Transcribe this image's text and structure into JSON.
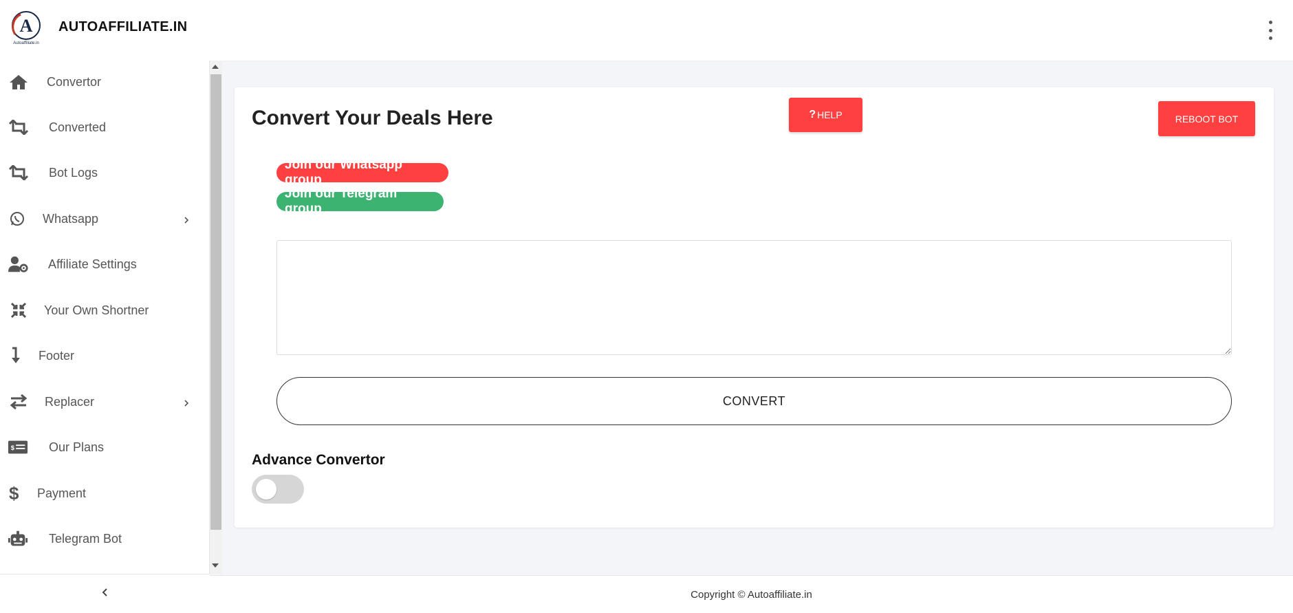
{
  "header": {
    "brand": "AUTOAFFILIATE.IN",
    "logo_caption": "Autoaffiliate.in",
    "more_icon": "kebab-vertical-icon"
  },
  "sidebar": {
    "items": [
      {
        "label": "Convertor",
        "icon": "home-icon"
      },
      {
        "label": "Converted",
        "icon": "repeat-icon"
      },
      {
        "label": "Bot Logs",
        "icon": "repeat-icon"
      },
      {
        "label": "Whatsapp",
        "icon": "whatsapp-icon",
        "has_submenu": true
      },
      {
        "label": "Affiliate Settings",
        "icon": "user-gear-icon"
      },
      {
        "label": "Your Own Shortner",
        "icon": "compress-icon"
      },
      {
        "label": "Footer",
        "icon": "arrow-down-turn-icon"
      },
      {
        "label": "Replacer",
        "icon": "exchange-icon",
        "has_submenu": true
      },
      {
        "label": "Our Plans",
        "icon": "money-card-icon"
      },
      {
        "label": "Payment",
        "icon": "dollar-icon"
      },
      {
        "label": "Telegram Bot",
        "icon": "robot-icon"
      }
    ],
    "collapse_icon": "chevron-left-icon"
  },
  "main": {
    "title": "Convert Your Deals Here",
    "help_label": "HELP",
    "reboot_label": "REBOOT BOT",
    "whatsapp_group_label": "Join our Whatsapp group",
    "telegram_group_label": "Join our Telegram group",
    "deal_input_value": "",
    "convert_label": "CONVERT",
    "advance_label": "Advance Convertor",
    "advance_enabled": false
  },
  "footer": {
    "copyright": "Copyright © Autoaffiliate.in"
  },
  "colors": {
    "accent_red": "#ff4040",
    "accent_green": "#3cb371",
    "icon_gray": "#555555"
  }
}
